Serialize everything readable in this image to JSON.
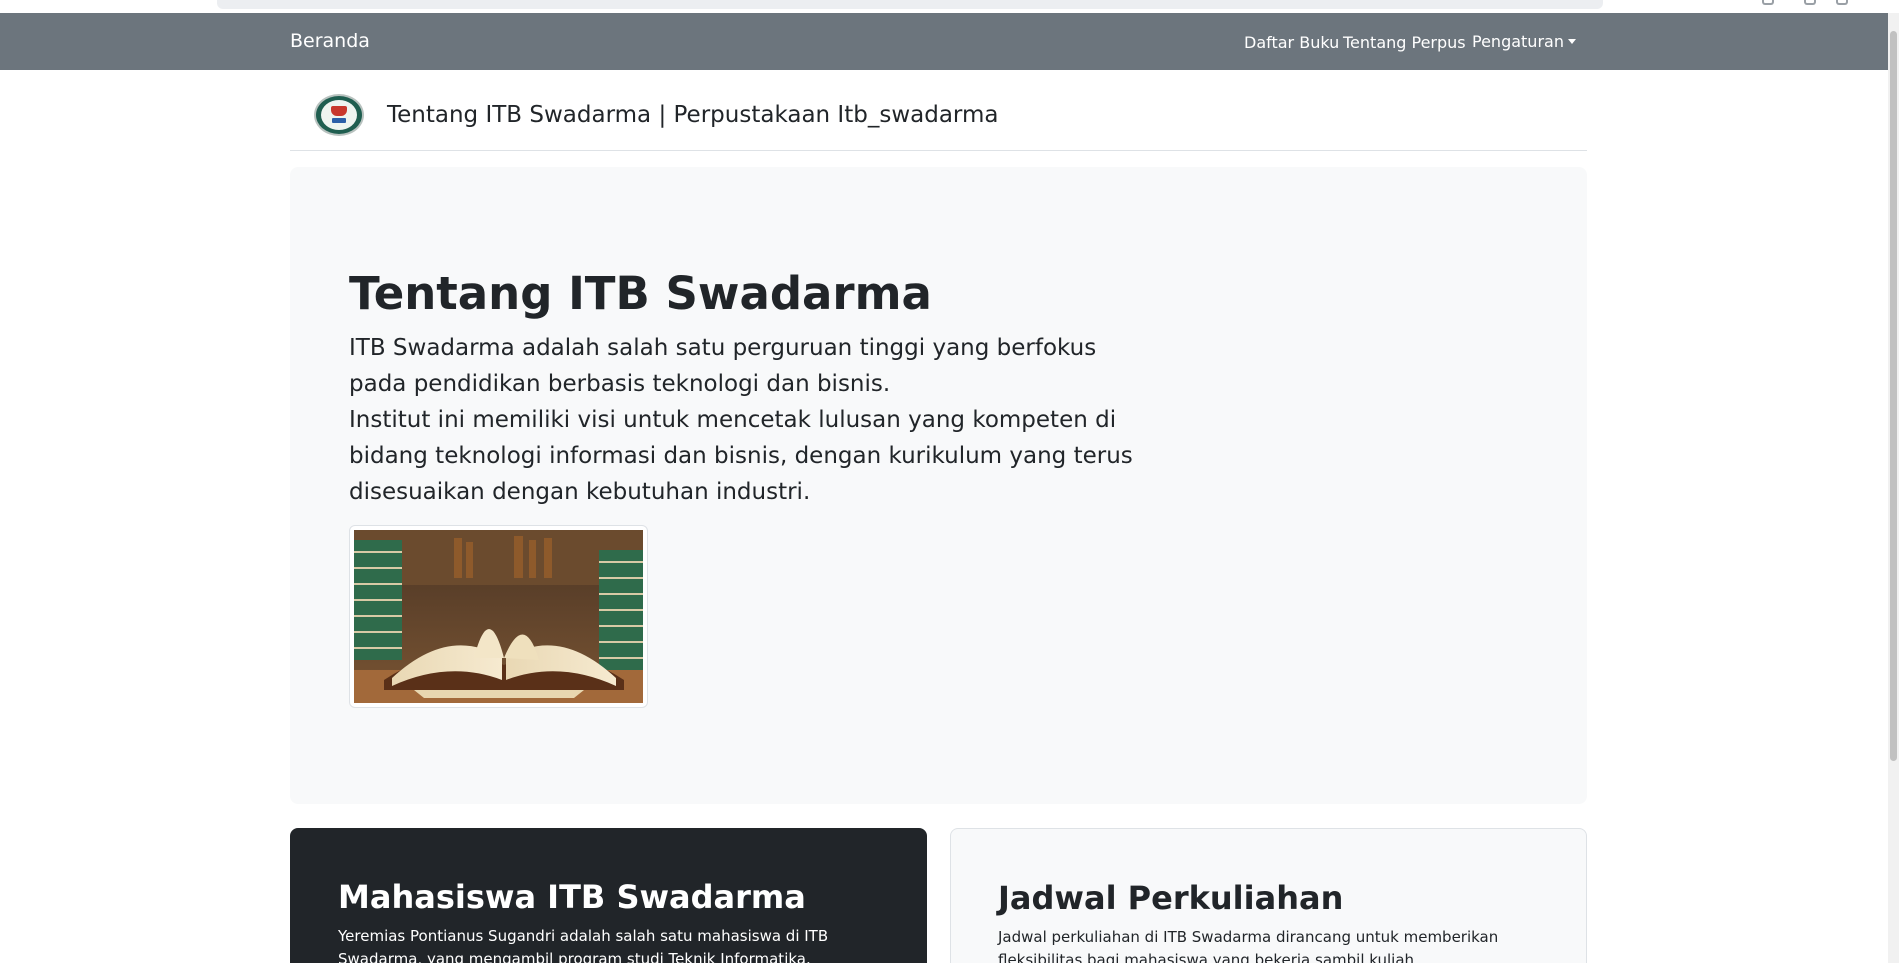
{
  "navbar": {
    "brand": "Beranda",
    "links": {
      "daftar_buku": "Daftar Buku",
      "tentang_perpus": "Tentang Perpus",
      "pengaturan": "Pengaturan"
    },
    "background": "#6c757d"
  },
  "header": {
    "title": "Tentang ITB Swadarma | Perpustakaan Itb_swadarma"
  },
  "jumbotron": {
    "title": "Tentang ITB Swadarma",
    "paragraph_1": "ITB Swadarma adalah salah satu perguruan tinggi yang berfokus pada pendidikan berbasis teknologi dan bisnis.",
    "paragraph_2": "Institut ini memiliki visi untuk mencetak lulusan yang kompeten di bidang teknologi informasi dan bisnis, dengan kurikulum yang terus disesuaikan dengan kebutuhan industri."
  },
  "cards": [
    {
      "title": "Mahasiswa ITB Swadarma",
      "text": "Yeremias Pontianus Sugandri adalah salah satu mahasiswa di ITB Swadarma, yang mengambil program studi Teknik Informatika."
    },
    {
      "title": "Jadwal Perkuliahan",
      "text": "Jadwal perkuliahan di ITB Swadarma dirancang untuk memberikan fleksibilitas bagi mahasiswa yang bekerja sambil kuliah."
    }
  ],
  "icons": {
    "logo": "itb-swadarma-logo",
    "dropdown": "caret-down-icon"
  }
}
